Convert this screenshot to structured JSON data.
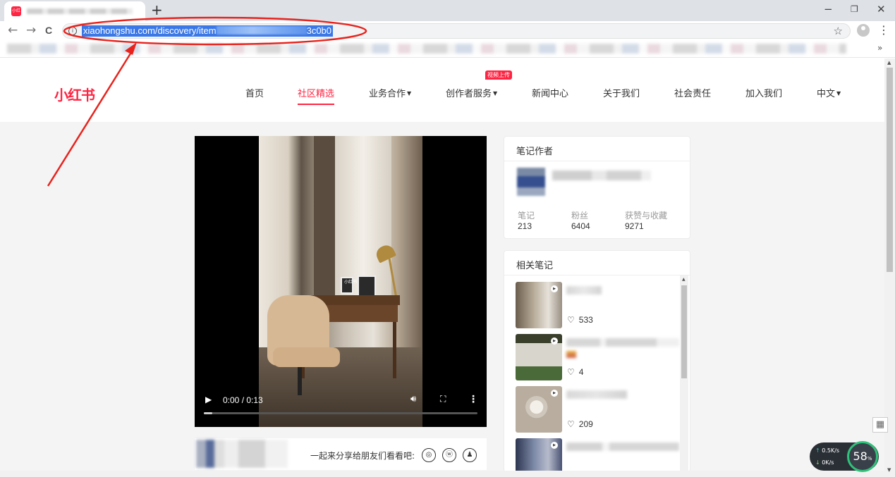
{
  "browser": {
    "new_tab_label": "+",
    "minimize_label": "−",
    "maximize_label": "❐",
    "close_label": "✕",
    "back_label": "←",
    "forward_label": "→",
    "reload_label": "C",
    "url_prefix": "xiaohongshu.com/discovery/item",
    "url_suffix": "3c0b0",
    "bookmark_more_label": "»"
  },
  "header": {
    "logo": "小红书",
    "nav": [
      {
        "label": "首页"
      },
      {
        "label": "社区精选",
        "active": true
      },
      {
        "label": "业务合作"
      },
      {
        "label": "创作者服务"
      },
      {
        "label": "新闻中心"
      },
      {
        "label": "关于我们"
      },
      {
        "label": "社会责任"
      },
      {
        "label": "加入我们"
      },
      {
        "label": "中文"
      }
    ],
    "badge": "视频上传"
  },
  "video": {
    "time": "0:00 / 0:13",
    "watermark": "小红书",
    "progress": 0.03
  },
  "share": {
    "text": "一起来分享给朋友们看看吧:"
  },
  "author_card": {
    "title": "笔记作者",
    "stats": [
      {
        "label": "笔记",
        "value": "213"
      },
      {
        "label": "粉丝",
        "value": "6404"
      },
      {
        "label": "获赞与收藏",
        "value": "9271"
      }
    ]
  },
  "related": {
    "title": "相关笔记",
    "items": [
      {
        "likes": "533"
      },
      {
        "likes": "4"
      },
      {
        "likes": "209"
      },
      {
        "likes": ""
      }
    ]
  },
  "net_widget": {
    "up": "0.5K/s",
    "down": "0K/s",
    "percent": "58"
  },
  "colors": {
    "brand": "#ff2442",
    "annotation": "#e8231d"
  }
}
